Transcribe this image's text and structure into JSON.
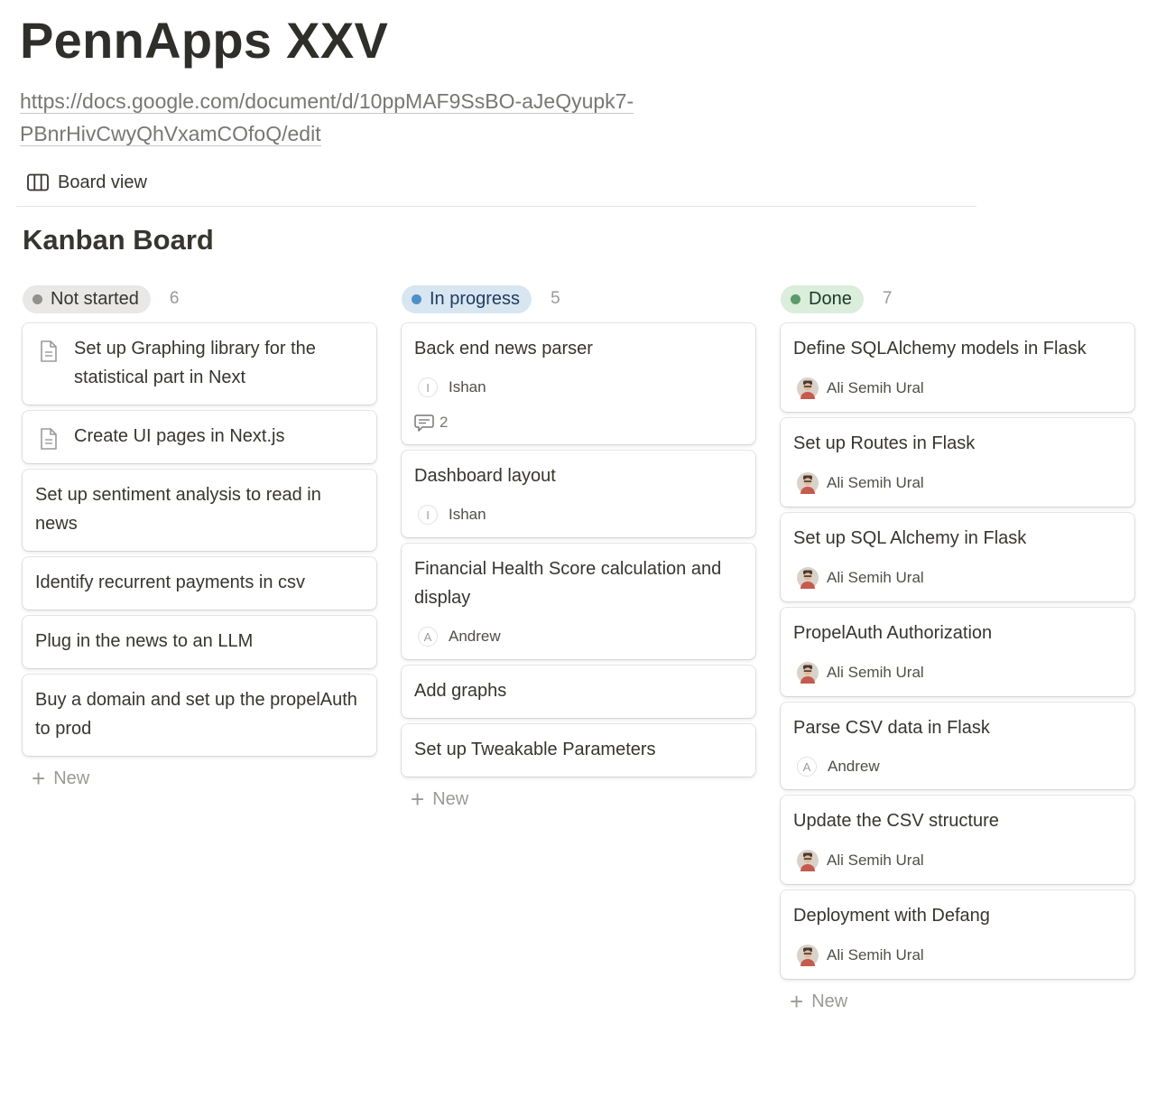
{
  "page": {
    "title": "PennApps XXV",
    "url_line1": "https://docs.google.com/document/d/10ppMAF9SsBO-aJeQyupk7-",
    "url_line2": "PBnrHivCwyQhVxamCOfoQ/edit"
  },
  "view": {
    "label": "Board view",
    "icon": "board-columns-icon"
  },
  "board": {
    "title": "Kanban Board",
    "new_label": "New"
  },
  "columns": [
    {
      "label": "Not started",
      "count": "6",
      "pill_bg": "#e9e8e6",
      "dot": "#91918e",
      "text": "#37352f",
      "cards": [
        {
          "title": "Set up Graphing library for the statistical part in Next",
          "icon": "document-icon"
        },
        {
          "title": "Create UI pages in Next.js",
          "icon": "document-icon"
        },
        {
          "title": "Set up sentiment analysis to read in news"
        },
        {
          "title": "Identify recurrent payments in csv"
        },
        {
          "title": "Plug in the news to an LLM"
        },
        {
          "title": "Buy a domain and set up the propelAuth to prod"
        }
      ]
    },
    {
      "label": "In progress",
      "count": "5",
      "pill_bg": "#d8e6f2",
      "dot": "#4f8fc9",
      "text": "#1d3c5c",
      "cards": [
        {
          "title": "Back end news parser",
          "assignee": "Ishan",
          "initial": "I",
          "comments": "2"
        },
        {
          "title": "Dashboard layout",
          "assignee": "Ishan",
          "initial": "I"
        },
        {
          "title": "Financial Health Score calculation and display",
          "assignee": "Andrew",
          "initial": "A"
        },
        {
          "title": "Add graphs"
        },
        {
          "title": "Set up Tweakable Parameters"
        }
      ]
    },
    {
      "label": "Done",
      "count": "7",
      "pill_bg": "#dbeddb",
      "dot": "#5a9a6b",
      "text": "#1c3829",
      "cards": [
        {
          "title": "Define SQLAlchemy models in Flask",
          "assignee": "Ali Semih Ural",
          "photo": true
        },
        {
          "title": "Set up Routes in Flask",
          "assignee": "Ali Semih Ural",
          "photo": true
        },
        {
          "title": "Set up SQL Alchemy in Flask",
          "assignee": "Ali Semih Ural",
          "photo": true
        },
        {
          "title": "PropelAuth Authorization",
          "assignee": "Ali Semih Ural",
          "photo": true
        },
        {
          "title": "Parse CSV data in Flask",
          "assignee": "Andrew",
          "initial": "A"
        },
        {
          "title": "Update the CSV structure",
          "assignee": "Ali Semih Ural",
          "photo": true
        },
        {
          "title": "Deployment with Defang",
          "assignee": "Ali Semih Ural",
          "photo": true
        }
      ]
    }
  ]
}
